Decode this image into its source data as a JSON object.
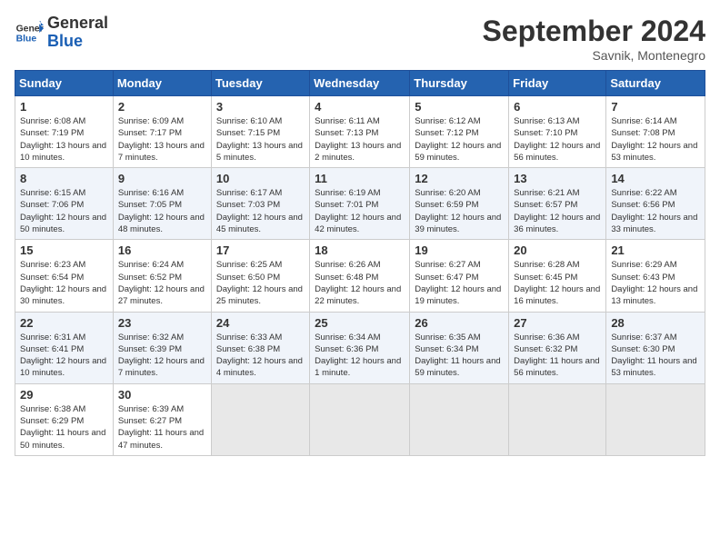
{
  "header": {
    "logo_general": "General",
    "logo_blue": "Blue",
    "month_title": "September 2024",
    "location": "Savnik, Montenegro"
  },
  "weekdays": [
    "Sunday",
    "Monday",
    "Tuesday",
    "Wednesday",
    "Thursday",
    "Friday",
    "Saturday"
  ],
  "weeks": [
    [
      {
        "day": "1",
        "info": "Sunrise: 6:08 AM\nSunset: 7:19 PM\nDaylight: 13 hours and 10 minutes."
      },
      {
        "day": "2",
        "info": "Sunrise: 6:09 AM\nSunset: 7:17 PM\nDaylight: 13 hours and 7 minutes."
      },
      {
        "day": "3",
        "info": "Sunrise: 6:10 AM\nSunset: 7:15 PM\nDaylight: 13 hours and 5 minutes."
      },
      {
        "day": "4",
        "info": "Sunrise: 6:11 AM\nSunset: 7:13 PM\nDaylight: 13 hours and 2 minutes."
      },
      {
        "day": "5",
        "info": "Sunrise: 6:12 AM\nSunset: 7:12 PM\nDaylight: 12 hours and 59 minutes."
      },
      {
        "day": "6",
        "info": "Sunrise: 6:13 AM\nSunset: 7:10 PM\nDaylight: 12 hours and 56 minutes."
      },
      {
        "day": "7",
        "info": "Sunrise: 6:14 AM\nSunset: 7:08 PM\nDaylight: 12 hours and 53 minutes."
      }
    ],
    [
      {
        "day": "8",
        "info": "Sunrise: 6:15 AM\nSunset: 7:06 PM\nDaylight: 12 hours and 50 minutes."
      },
      {
        "day": "9",
        "info": "Sunrise: 6:16 AM\nSunset: 7:05 PM\nDaylight: 12 hours and 48 minutes."
      },
      {
        "day": "10",
        "info": "Sunrise: 6:17 AM\nSunset: 7:03 PM\nDaylight: 12 hours and 45 minutes."
      },
      {
        "day": "11",
        "info": "Sunrise: 6:19 AM\nSunset: 7:01 PM\nDaylight: 12 hours and 42 minutes."
      },
      {
        "day": "12",
        "info": "Sunrise: 6:20 AM\nSunset: 6:59 PM\nDaylight: 12 hours and 39 minutes."
      },
      {
        "day": "13",
        "info": "Sunrise: 6:21 AM\nSunset: 6:57 PM\nDaylight: 12 hours and 36 minutes."
      },
      {
        "day": "14",
        "info": "Sunrise: 6:22 AM\nSunset: 6:56 PM\nDaylight: 12 hours and 33 minutes."
      }
    ],
    [
      {
        "day": "15",
        "info": "Sunrise: 6:23 AM\nSunset: 6:54 PM\nDaylight: 12 hours and 30 minutes."
      },
      {
        "day": "16",
        "info": "Sunrise: 6:24 AM\nSunset: 6:52 PM\nDaylight: 12 hours and 27 minutes."
      },
      {
        "day": "17",
        "info": "Sunrise: 6:25 AM\nSunset: 6:50 PM\nDaylight: 12 hours and 25 minutes."
      },
      {
        "day": "18",
        "info": "Sunrise: 6:26 AM\nSunset: 6:48 PM\nDaylight: 12 hours and 22 minutes."
      },
      {
        "day": "19",
        "info": "Sunrise: 6:27 AM\nSunset: 6:47 PM\nDaylight: 12 hours and 19 minutes."
      },
      {
        "day": "20",
        "info": "Sunrise: 6:28 AM\nSunset: 6:45 PM\nDaylight: 12 hours and 16 minutes."
      },
      {
        "day": "21",
        "info": "Sunrise: 6:29 AM\nSunset: 6:43 PM\nDaylight: 12 hours and 13 minutes."
      }
    ],
    [
      {
        "day": "22",
        "info": "Sunrise: 6:31 AM\nSunset: 6:41 PM\nDaylight: 12 hours and 10 minutes."
      },
      {
        "day": "23",
        "info": "Sunrise: 6:32 AM\nSunset: 6:39 PM\nDaylight: 12 hours and 7 minutes."
      },
      {
        "day": "24",
        "info": "Sunrise: 6:33 AM\nSunset: 6:38 PM\nDaylight: 12 hours and 4 minutes."
      },
      {
        "day": "25",
        "info": "Sunrise: 6:34 AM\nSunset: 6:36 PM\nDaylight: 12 hours and 1 minute."
      },
      {
        "day": "26",
        "info": "Sunrise: 6:35 AM\nSunset: 6:34 PM\nDaylight: 11 hours and 59 minutes."
      },
      {
        "day": "27",
        "info": "Sunrise: 6:36 AM\nSunset: 6:32 PM\nDaylight: 11 hours and 56 minutes."
      },
      {
        "day": "28",
        "info": "Sunrise: 6:37 AM\nSunset: 6:30 PM\nDaylight: 11 hours and 53 minutes."
      }
    ],
    [
      {
        "day": "29",
        "info": "Sunrise: 6:38 AM\nSunset: 6:29 PM\nDaylight: 11 hours and 50 minutes."
      },
      {
        "day": "30",
        "info": "Sunrise: 6:39 AM\nSunset: 6:27 PM\nDaylight: 11 hours and 47 minutes."
      },
      {
        "day": "",
        "info": ""
      },
      {
        "day": "",
        "info": ""
      },
      {
        "day": "",
        "info": ""
      },
      {
        "day": "",
        "info": ""
      },
      {
        "day": "",
        "info": ""
      }
    ]
  ]
}
